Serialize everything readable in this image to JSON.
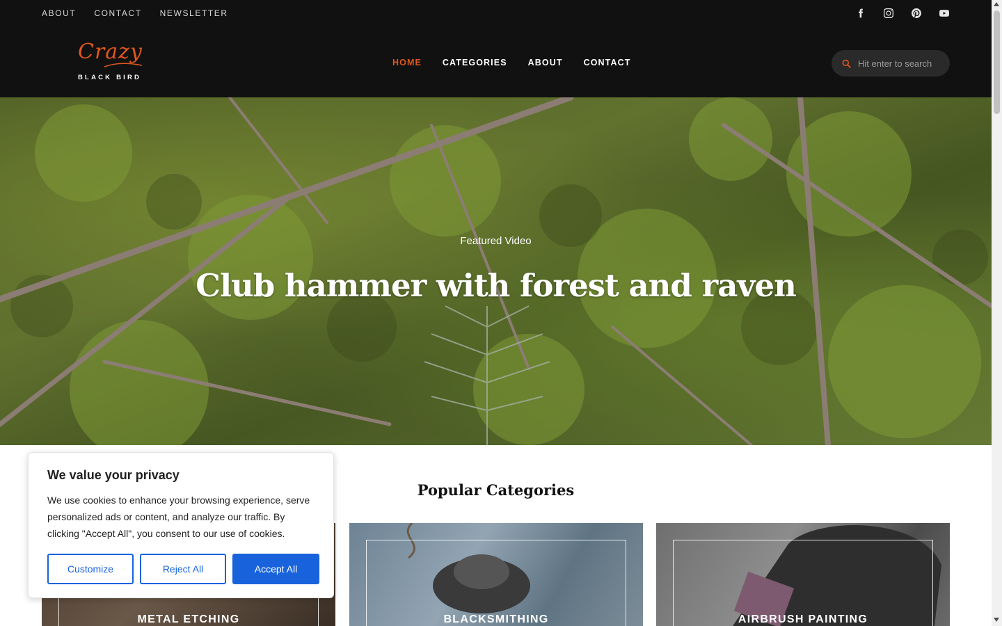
{
  "topbar": {
    "links": [
      "ABOUT",
      "CONTACT",
      "NEWSLETTER"
    ],
    "social_icons": [
      "facebook-icon",
      "instagram-icon",
      "pinterest-icon",
      "youtube-icon"
    ]
  },
  "logo": {
    "script_text": "Crazy",
    "sub_text": "BLACK BIRD"
  },
  "nav": {
    "items": [
      "HOME",
      "CATEGORIES",
      "ABOUT",
      "CONTACT"
    ],
    "active": "HOME"
  },
  "search": {
    "placeholder": "Hit enter to search",
    "icon": "search-icon"
  },
  "hero": {
    "kicker": "Featured Video",
    "title": "Club hammer with forest and raven"
  },
  "popular": {
    "title": "Popular Categories",
    "categories": [
      "METAL ETCHING",
      "BLACKSMITHING",
      "AIRBRUSH PAINTING"
    ]
  },
  "cookie": {
    "title": "We value your privacy",
    "body": "We use cookies to enhance your browsing experience, serve personalized ads or content, and analyze our traffic. By clicking \"Accept All\", you consent to our use of cookies.",
    "customize": "Customize",
    "reject": "Reject All",
    "accept": "Accept All"
  },
  "colors": {
    "accent": "#e1571c",
    "header_bg": "#111111",
    "cookie_button": "#1863dc"
  }
}
